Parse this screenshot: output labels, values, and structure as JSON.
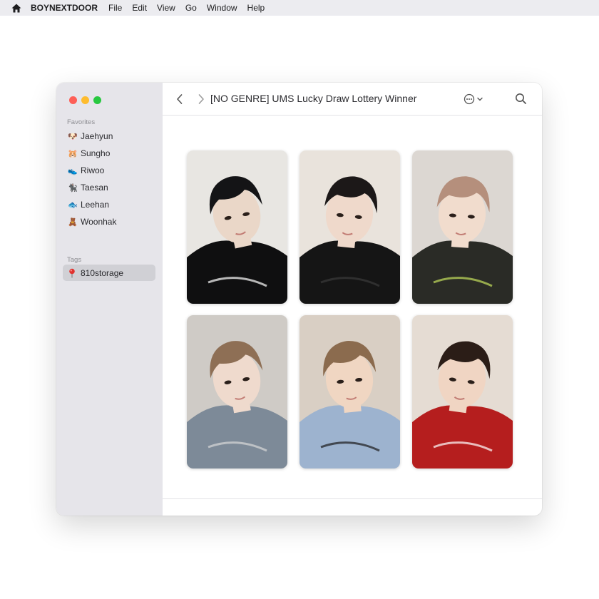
{
  "menubar": {
    "home_icon": "house-icon",
    "app_name": "BOYNEXTDOOR",
    "items": [
      "File",
      "Edit",
      "View",
      "Go",
      "Window",
      "Help"
    ]
  },
  "window": {
    "title": "[NO GENRE] UMS Lucky Draw Lottery Winner",
    "traffic_colors": [
      "#fe5f57",
      "#febc2e",
      "#28c840"
    ]
  },
  "sidebar": {
    "favorites_title": "Favorites",
    "favorites": [
      {
        "emoji": "🐶",
        "label": "Jaehyun"
      },
      {
        "emoji": "🐹",
        "label": "Sungho"
      },
      {
        "emoji": "👟",
        "label": "Riwoo"
      },
      {
        "emoji": "🐈‍⬛",
        "label": "Taesan"
      },
      {
        "emoji": "🐟",
        "label": "Leehan"
      },
      {
        "emoji": "🧸",
        "label": "Woonhak"
      }
    ],
    "tags_title": "Tags",
    "tags": [
      {
        "icon": "map-pin-icon",
        "label": "810storage"
      }
    ]
  },
  "photos": [
    {
      "name": "photocard-1",
      "bg": "#e8e6e2",
      "hair": "#141416",
      "skin": "#ead7c8",
      "cloth": "#0f0f10",
      "accent": "#ffffff"
    },
    {
      "name": "photocard-2",
      "bg": "#e9e3dc",
      "hair": "#1c1818",
      "skin": "#efd9cb",
      "cloth": "#151515",
      "accent": "#3a3a3a"
    },
    {
      "name": "photocard-3",
      "bg": "#dcd7d2",
      "hair": "#b58f7c",
      "skin": "#f1dccd",
      "cloth": "#2a2b26",
      "accent": "#c4e05c"
    },
    {
      "name": "photocard-4",
      "bg": "#cfcbc6",
      "hair": "#8e6f55",
      "skin": "#efdacd",
      "cloth": "#7d8a98",
      "accent": "#d9d9d9"
    },
    {
      "name": "photocard-5",
      "bg": "#d9cfc4",
      "hair": "#8b6b4e",
      "skin": "#f0d6c2",
      "cloth": "#9db3cf",
      "accent": "#1b1b1b"
    },
    {
      "name": "photocard-6",
      "bg": "#e5dcd3",
      "hair": "#2b1d17",
      "skin": "#f0d5c3",
      "cloth": "#b51e1e",
      "accent": "#ffffff"
    }
  ]
}
